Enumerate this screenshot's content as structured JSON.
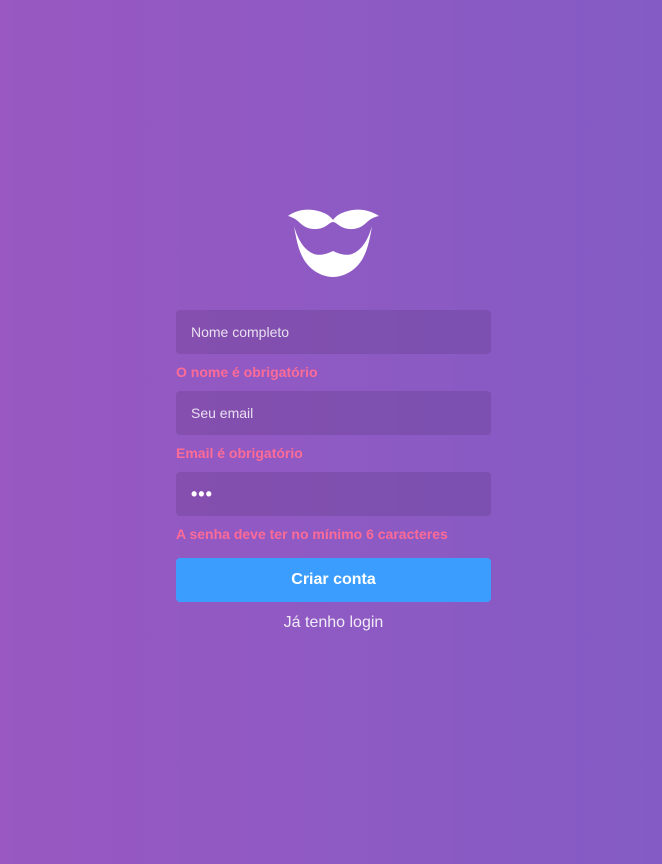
{
  "logo": {
    "icon": "mustache-beard-icon",
    "color": "#ffffff"
  },
  "form": {
    "name": {
      "placeholder": "Nome completo",
      "value": "",
      "error": "O nome é obrigatório"
    },
    "email": {
      "placeholder": "Seu email",
      "value": "",
      "error": "Email é obrigatório"
    },
    "password": {
      "placeholder": "",
      "value": "•••",
      "error": "A senha deve ter no mínimo 6 caracteres"
    },
    "submit_label": "Criar conta",
    "login_link_label": "Já tenho login"
  },
  "colors": {
    "background_start": "#9958c2",
    "background_end": "#845bc4",
    "error": "#fd6b97",
    "button": "#3b9eff"
  }
}
